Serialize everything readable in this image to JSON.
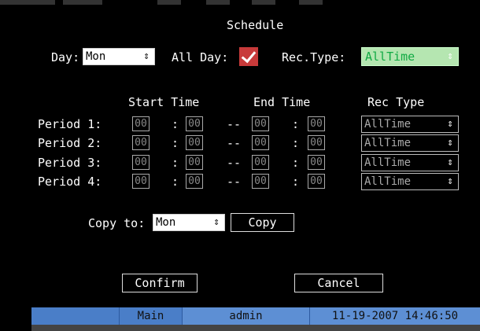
{
  "title": "Schedule",
  "day": {
    "label": "Day:",
    "value": "Mon"
  },
  "all_day": {
    "label": "All Day:",
    "checked": true
  },
  "rec_type": {
    "label": "Rec.Type:",
    "value": "AllTime"
  },
  "headers": {
    "start": "Start Time",
    "end": "End Time",
    "rec": "Rec Type"
  },
  "periods": [
    {
      "label": "Period 1:",
      "start_h": "00",
      "start_m": "00",
      "end_h": "00",
      "end_m": "00",
      "rec": "AllTime"
    },
    {
      "label": "Period 2:",
      "start_h": "00",
      "start_m": "00",
      "end_h": "00",
      "end_m": "00",
      "rec": "AllTime"
    },
    {
      "label": "Period 3:",
      "start_h": "00",
      "start_m": "00",
      "end_h": "00",
      "end_m": "00",
      "rec": "AllTime"
    },
    {
      "label": "Period 4:",
      "start_h": "00",
      "start_m": "00",
      "end_h": "00",
      "end_m": "00",
      "rec": "AllTime"
    }
  ],
  "colon": ":",
  "dash": "--",
  "copy": {
    "label": "Copy to:",
    "value": "Mon",
    "button": "Copy"
  },
  "buttons": {
    "confirm": "Confirm",
    "cancel": "Cancel"
  },
  "status": {
    "main": "Main",
    "user": "admin",
    "datetime": "11-19-2007 14:46:50"
  },
  "colors": {
    "status_bar": "#5d8fd4",
    "rec_type_bg": "#b5e6b1",
    "checkbox": "#c83a3a"
  }
}
